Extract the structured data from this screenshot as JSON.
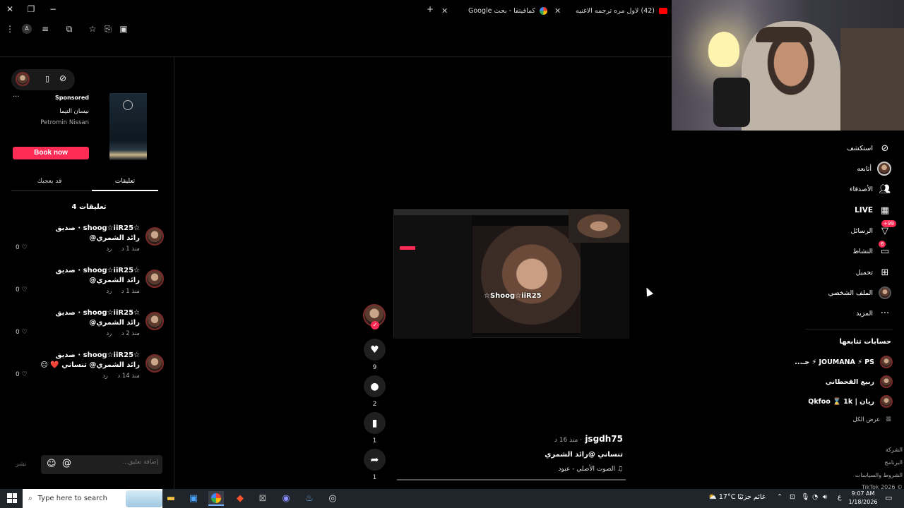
{
  "browser": {
    "tabs": [
      {
        "title": "(42) لاول مره ترجمه الاغنيه العسـ",
        "icon": "youtube-icon"
      },
      {
        "title": "كمافيتقا - بحث Google",
        "icon": "google-icon"
      }
    ]
  },
  "left_panel": {
    "ad": {
      "sponsored": "Sponsored",
      "title": "نيسان التيما",
      "advertiser": "Petromin Nissan",
      "button": "Book now"
    },
    "tabs": {
      "comments": "تعليقات",
      "may_like": "قد يعجبك"
    },
    "comments_count": "4 تعليقات",
    "comments": [
      {
        "user": "☆shoog☆iiR25 · صديق",
        "text": "رائد الشمري@",
        "time": "منذ 1 د",
        "reply": "رد",
        "likes": "0"
      },
      {
        "user": "☆shoog☆iiR25 · صديق",
        "text": "رائد الشمري@",
        "time": "منذ 1 د",
        "reply": "رد",
        "likes": "0"
      },
      {
        "user": "☆shoog☆iiR25 · صديق",
        "text": "رائد الشمري@",
        "time": "منذ 2 د",
        "reply": "رد",
        "likes": "0"
      },
      {
        "user": "☆shoog☆iiR25 · صديق",
        "text": "رائد الشمري@ تنساني ❤️ 😑",
        "time": "منذ 14 د",
        "reply": "رد",
        "likes": "0"
      }
    ],
    "input_placeholder": "إضافة تعليق...",
    "post_label": "نشر"
  },
  "video": {
    "overlay_name": "☆Shoog☆iiR25",
    "likes": "9",
    "comments": "2",
    "saves": "1",
    "shares": "1",
    "author": "jsgdh75",
    "time": "· منذ 16 د",
    "caption": "تنساني @رائد الشمري",
    "sound": "الصوت الأصلي - عبود"
  },
  "right_nav": {
    "items": [
      {
        "label": "استكشف",
        "icon": "compass-icon"
      },
      {
        "label": "أتابعه",
        "icon": "avatar-icon"
      },
      {
        "label": "الأصدقاء",
        "icon": "friends-icon"
      },
      {
        "label": "LIVE",
        "icon": "live-icon"
      },
      {
        "label": "الرسائل",
        "icon": "messages-icon",
        "badge": "99+"
      },
      {
        "label": "النشاط",
        "icon": "activity-icon",
        "badge": "6"
      },
      {
        "label": "تحميل",
        "icon": "upload-icon"
      },
      {
        "label": "الملف الشخصي",
        "icon": "profile-icon"
      },
      {
        "label": "المزيد",
        "icon": "more-icon"
      }
    ],
    "following_title": "حسابات تتابعها",
    "following": [
      "JOUMANA ⚡ PS ⚡ جـ...",
      "ربيع القحطاني",
      "ريان | Qkfoo ⌛ 1k"
    ],
    "see_all": "عرض الكل",
    "footer": [
      "الشركة",
      "البرنامج",
      "الشروط والسياسات",
      "© 2026 TikTok"
    ]
  },
  "taskbar": {
    "search_placeholder": "Type here to search",
    "weather": "17°C  غائم جزئيًا",
    "lang": "ع",
    "time": "9:07 AM",
    "date": "1/18/2026"
  }
}
